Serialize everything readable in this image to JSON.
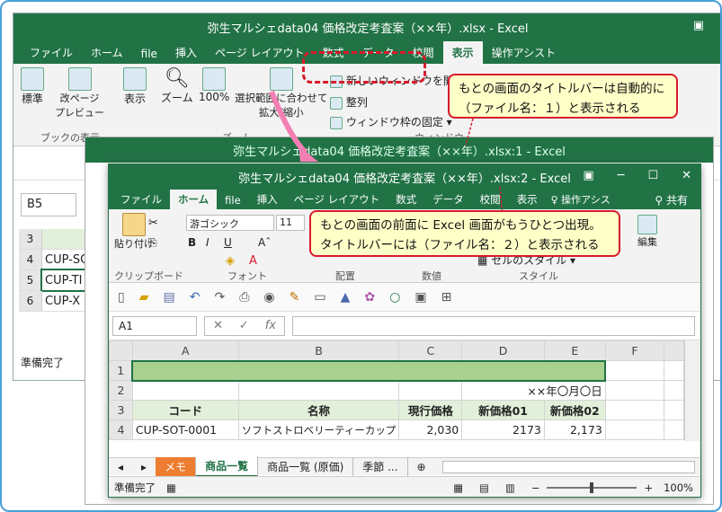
{
  "back_window": {
    "title": "弥生マルシェdata04  価格改定考査案（××年）.xlsx - Excel",
    "tabs": [
      "ファイル",
      "ホーム",
      "file",
      "挿入",
      "ページ レイアウト",
      "数式",
      "データ",
      "校閲",
      "表示",
      "操作アシスト"
    ],
    "active_tab": "表示",
    "ribbon": {
      "normal": "標準",
      "pagebreak": "改ページ\nプレビュー",
      "book_view_group": "ブックの表示",
      "show": "表示",
      "zoom": "ズーム",
      "zoom100": "100%",
      "zoom_selection": "選択範囲に合わせて\n拡大/縮小",
      "zoom_group": "ズーム",
      "new_window": "新しいウィンドウを開く",
      "arrange": "整列",
      "freeze": "ウィンドウ枠の固定",
      "window_group": "ウィンドウ"
    },
    "namebox": "B5",
    "rows": [
      {
        "num": "3",
        "val": ""
      },
      {
        "num": "4",
        "val": "CUP-SO"
      },
      {
        "num": "5",
        "val": "CUP-TI"
      },
      {
        "num": "6",
        "val": "CUP-X"
      }
    ],
    "status": "準備完了"
  },
  "mid_window": {
    "title": "弥生マルシェdata04  価格改定考査案（××年）.xlsx:1 - Excel"
  },
  "front_window": {
    "title": "弥生マルシェdata04  価格改定考査案（××年）.xlsx:2 - Excel",
    "tabs": [
      "ファイル",
      "ホーム",
      "file",
      "挿入",
      "ページ レイアウト",
      "数式",
      "データ",
      "校閲",
      "表示"
    ],
    "active_tab": "ホーム",
    "tell_me": "操作アシス",
    "share": "共有",
    "ribbon": {
      "paste": "貼り付け",
      "clipboard": "クリップボード",
      "font_name": "游ゴシック",
      "font_size": "11",
      "font_group": "フォント",
      "align_group": "配置",
      "number_group": "数値",
      "cell_style": "セルのスタイル",
      "style_group": "スタイル",
      "edit": "編集"
    },
    "namebox": "A1",
    "columns": [
      "A",
      "B",
      "C",
      "D",
      "E",
      "F"
    ],
    "date_text": "××年〇月〇日",
    "headers": [
      "コード",
      "名称",
      "現行価格",
      "新価格01",
      "新価格02"
    ],
    "row4": [
      "CUP-SOT-0001",
      "ソフトストロベリーティーカップ",
      "2,030",
      "2173",
      "2,173"
    ],
    "sheet_tabs": [
      "メモ",
      "商品一覧",
      "商品一覧 (原価)",
      "季節 ..."
    ],
    "status": "準備完了",
    "zoom": "100%"
  },
  "callouts": {
    "c1": "もとの画面のタイトルバーは自動的に\n（ファイル名：１）と表示される",
    "c2": "もとの画面の前面に Excel 画面がもうひとつ出現。\nタイトルバーには（ファイル名：２）と表示される"
  }
}
